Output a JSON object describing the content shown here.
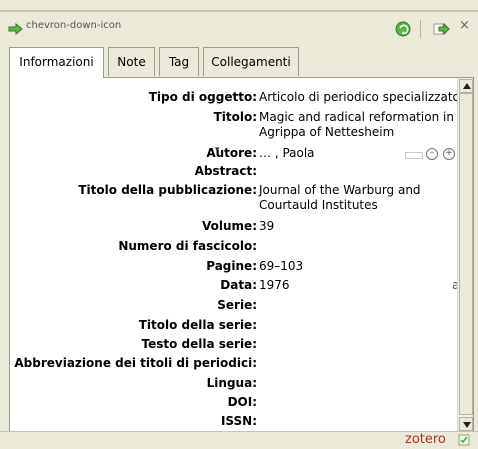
{
  "toolbar": {
    "arrow_icon": "green-right-arrow-icon",
    "dropdown_icon": "chevron-down-icon",
    "sync_icon": "sync-icon",
    "go_icon": "go-arrow-icon",
    "close_text": "×"
  },
  "tabs": [
    {
      "label": "Informazioni"
    },
    {
      "label": "Note"
    },
    {
      "label": "Tag"
    },
    {
      "label": "Collegamenti"
    }
  ],
  "fields": [
    {
      "label": "Tipo di oggetto:",
      "value": "Articolo di periodico specializzato"
    },
    {
      "label": "Titolo:",
      "value": "Magic and radical reformation in Agrippa of Nettesheim"
    },
    {
      "label": "Autore:",
      "value": "… , Paola"
    },
    {
      "label": "Abstract:",
      "value": ""
    },
    {
      "label": "Titolo della pubblicazione:",
      "value": "Journal of the Warburg and Courtauld Institutes"
    },
    {
      "label": "Volume:",
      "value": "39"
    },
    {
      "label": "Numero di fascicolo:",
      "value": ""
    },
    {
      "label": "Pagine:",
      "value": "69–103"
    },
    {
      "label": "Data:",
      "value": "1976"
    },
    {
      "label": "Serie:",
      "value": ""
    },
    {
      "label": "Titolo della serie:",
      "value": ""
    },
    {
      "label": "Testo della serie:",
      "value": ""
    },
    {
      "label": "Abbreviazione dei titoli di periodici:",
      "value": ""
    },
    {
      "label": "Lingua:",
      "value": ""
    },
    {
      "label": "DOI:",
      "value": ""
    },
    {
      "label": "ISSN:",
      "value": ""
    }
  ],
  "author_controls": {
    "twisty": "▾",
    "minus": "–",
    "plus": "+"
  },
  "date_suffix": "a",
  "brand": "zotero",
  "colors": {
    "brand": "#b42f25",
    "accent": "#4aa83a"
  }
}
